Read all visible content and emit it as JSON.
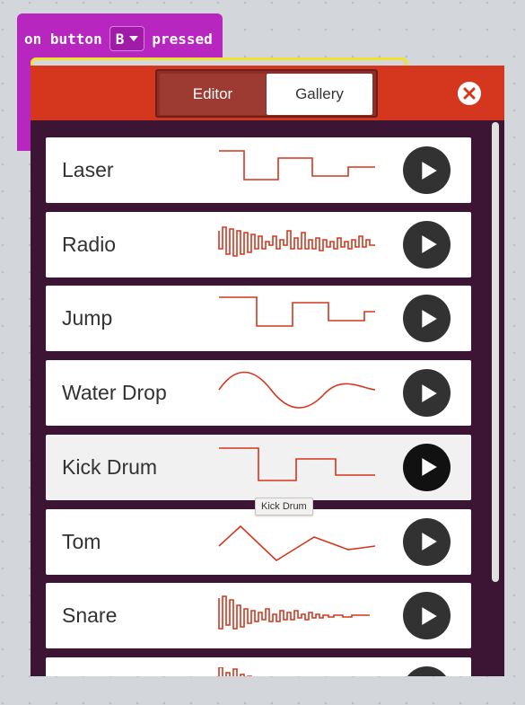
{
  "block": {
    "text_on": "on button",
    "button_value": "B",
    "text_pressed": "pressed",
    "color": "#b726bf"
  },
  "dialog": {
    "tabs": [
      {
        "label": "Editor",
        "selected": false
      },
      {
        "label": "Gallery",
        "selected": true
      }
    ],
    "close_icon": "close-icon",
    "header_color": "#d4371e",
    "body_color": "#3c1535"
  },
  "sounds": [
    {
      "label": "Laser",
      "wave": "laser"
    },
    {
      "label": "Radio",
      "wave": "radio"
    },
    {
      "label": "Jump",
      "wave": "jump"
    },
    {
      "label": "Water Drop",
      "wave": "water"
    },
    {
      "label": "Kick Drum",
      "wave": "kick",
      "hover": true
    },
    {
      "label": "Tom",
      "wave": "tom"
    },
    {
      "label": "Snare",
      "wave": "snare"
    },
    {
      "label": "",
      "wave": "partial"
    }
  ],
  "tooltip": "Kick Drum",
  "wave_color": "#d4371e"
}
